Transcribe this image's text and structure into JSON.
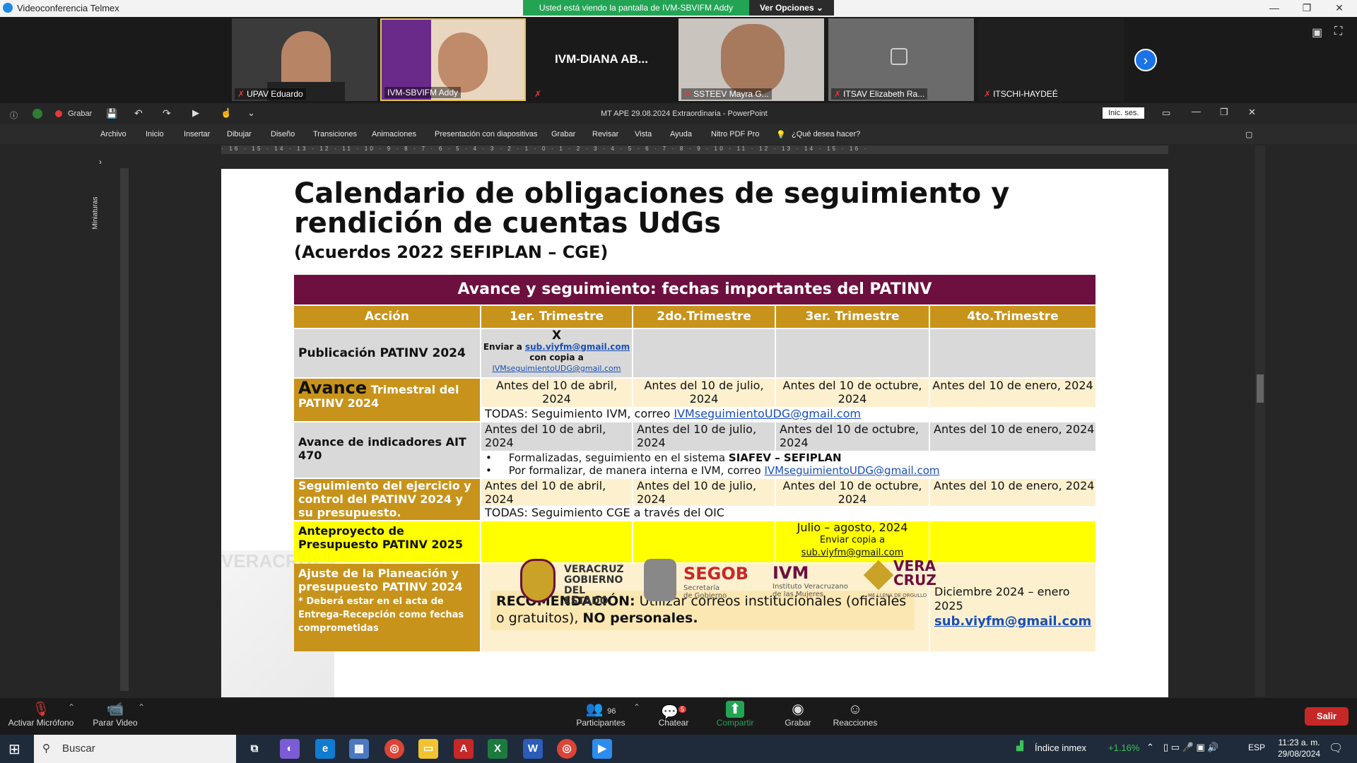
{
  "window": {
    "title": "Videoconferencia Telmex",
    "share_banner": "Usted está viendo la pantalla de IVM-SBVIFM Addy",
    "view_options": "Ver Opciones"
  },
  "participants": [
    {
      "name": "UPAV Eduardo",
      "video": true
    },
    {
      "name": "IVM-SBVIFM Addy",
      "video": true
    },
    {
      "name": "IVM-DIANA AB...",
      "video": false
    },
    {
      "name": "SSTEEV Mayra G...",
      "video": true
    },
    {
      "name": "ITSAV Elizabeth Ra...",
      "video": false
    },
    {
      "name": "ITSCHI-HAYDEÉ",
      "video": false
    }
  ],
  "ppt": {
    "record_label": "Grabar",
    "doc_title": "MT APE 29.08.2024 Extraordinaria  -  PowerPoint",
    "signin": "Inic. ses.",
    "tabs": [
      "Archivo",
      "Inicio",
      "Insertar",
      "Dibujar",
      "Diseño",
      "Transiciones",
      "Animaciones",
      "Presentación con diapositivas",
      "Grabar",
      "Revisar",
      "Vista",
      "Ayuda",
      "Nitro PDF Pro"
    ],
    "tell_me": "¿Qué desea hacer?",
    "thumbnails_label": "Miniaturas",
    "ruler_ticks": "· 16 · 15 · 14 · 13 · 12 · 11 · 10 · 9 · 8 · 7 · 6 · 5 · 4 · 3 · 2 · 1 · 0 · 1 · 2 · 3 · 4 · 5 · 6 · 7 · 8 · 9 · 10 · 11 · 12 · 13 · 14 · 15 · 16 ·"
  },
  "slide": {
    "title_line1": "Calendario de obligaciones de seguimiento y",
    "title_line2": "rendición de cuentas  UdGs",
    "subtitle": "(Acuerdos 2022 SEFIPLAN – CGE)",
    "banner": "Avance y seguimiento: fechas importantes del PATINV",
    "headers": [
      "Acción",
      "1er. Trimestre",
      "2do.Trimestre",
      "3er. Trimestre",
      "4to.Trimestre"
    ],
    "row1": {
      "action": "Publicación PATINV 2024",
      "x_mark": "X",
      "send_to": "Enviar a",
      "send_email": "sub.viyfm@gmail.com",
      "copy_label": "con copia a",
      "copy_email": "IVMseguimientoUDG@gmail.com"
    },
    "row2": {
      "action_big": "Avance",
      "action_rest": "Trimestral del PATINV 2024",
      "q1": "Antes del 10 de abril, 2024",
      "q2": "Antes del 10 de julio, 2024",
      "q3": "Antes del 10 de octubre, 2024",
      "q4": "Antes del 10 de enero, 2024",
      "note_prefix": "TODAS: Seguimiento IVM, correo",
      "note_email": "IVMseguimientoUDG@gmail.com"
    },
    "row3": {
      "action": "Avance de indicadores AIT 470",
      "q1": "Antes del 10 de abril, 2024",
      "q2": "Antes del 10 de julio, 2024",
      "q3": "Antes del 10 de octubre, 2024",
      "q4": "Antes del 10 de enero, 2024",
      "bullet1_prefix": "Formalizadas, seguimiento en el sistema",
      "bullet1_bold": "SIAFEV – SEFIPLAN",
      "bullet2_prefix": "Por formalizar, de manera interna e IVM, correo",
      "bullet2_email": "IVMseguimientoUDG@gmail.com"
    },
    "row4": {
      "action": "Seguimiento del ejercicio y control del PATINV 2024 y su presupuesto.",
      "q1": "Antes del 10 de abril, 2024",
      "q2": "Antes del 10 de julio, 2024",
      "q3": "Antes del 10 de octubre, 2024",
      "q4": "Antes del 10 de enero, 2024",
      "note": "TODAS: Seguimiento CGE a través del OIC"
    },
    "row5": {
      "action": "Anteproyecto de Presupuesto PATINV 2025",
      "q3_line1": "Julio – agosto, 2024",
      "q3_line2": "Enviar copia a",
      "q3_email": "sub.viyfm@gmail.com"
    },
    "row6": {
      "action": "Ajuste de la Planeación y presupuesto PATINV 2024",
      "action_note": "* Deberá estar en el acta de Entrega-Recepción como fechas comprometidas",
      "rec_bold": "RECOMENDACIÓN:",
      "rec_text": " Utilizar correos institucionales (oficiales o gratuitos),",
      "rec_bold2": "NO personales.",
      "q4_text": "Diciembre 2024 – enero 2025",
      "q4_email": "sub.viyfm@gmail.com"
    },
    "logos": {
      "veracruz_1": "VERACRUZ",
      "veracruz_2": "GOBIERNO",
      "veracruz_3": "DEL ESTADO",
      "segob": "SEGOB",
      "segob_sub1": "Secretaría",
      "segob_sub2": "de Gobierno",
      "ivm": "IVM",
      "ivm_sub1": "Instituto Veracruzano",
      "ivm_sub2": "de las Mujeres",
      "vera": "VERA",
      "cruz": "CRUZ",
      "vera_sub": "ME LLENA DE ORGULLO"
    },
    "watermark": "VERACRUZ"
  },
  "zoom_toolbar": {
    "mic": "Activar Micrófono",
    "video": "Parar Video",
    "participants": "Participantes",
    "participants_count": "96",
    "chat": "Chatear",
    "chat_badge": "5",
    "share": "Compartir",
    "record": "Grabar",
    "reactions": "Reacciones",
    "leave": "Salir"
  },
  "taskbar": {
    "search_placeholder": "Buscar",
    "stock_name": "Índice inmex",
    "stock_change": "+1.16%",
    "lang": "ESP",
    "time": "11:23 a. m.",
    "date": "29/08/2024"
  },
  "colors": {
    "banner": "#6d0f3f",
    "header_gold": "#c7931a",
    "share_green": "#23a455",
    "leave_red": "#c62828"
  }
}
